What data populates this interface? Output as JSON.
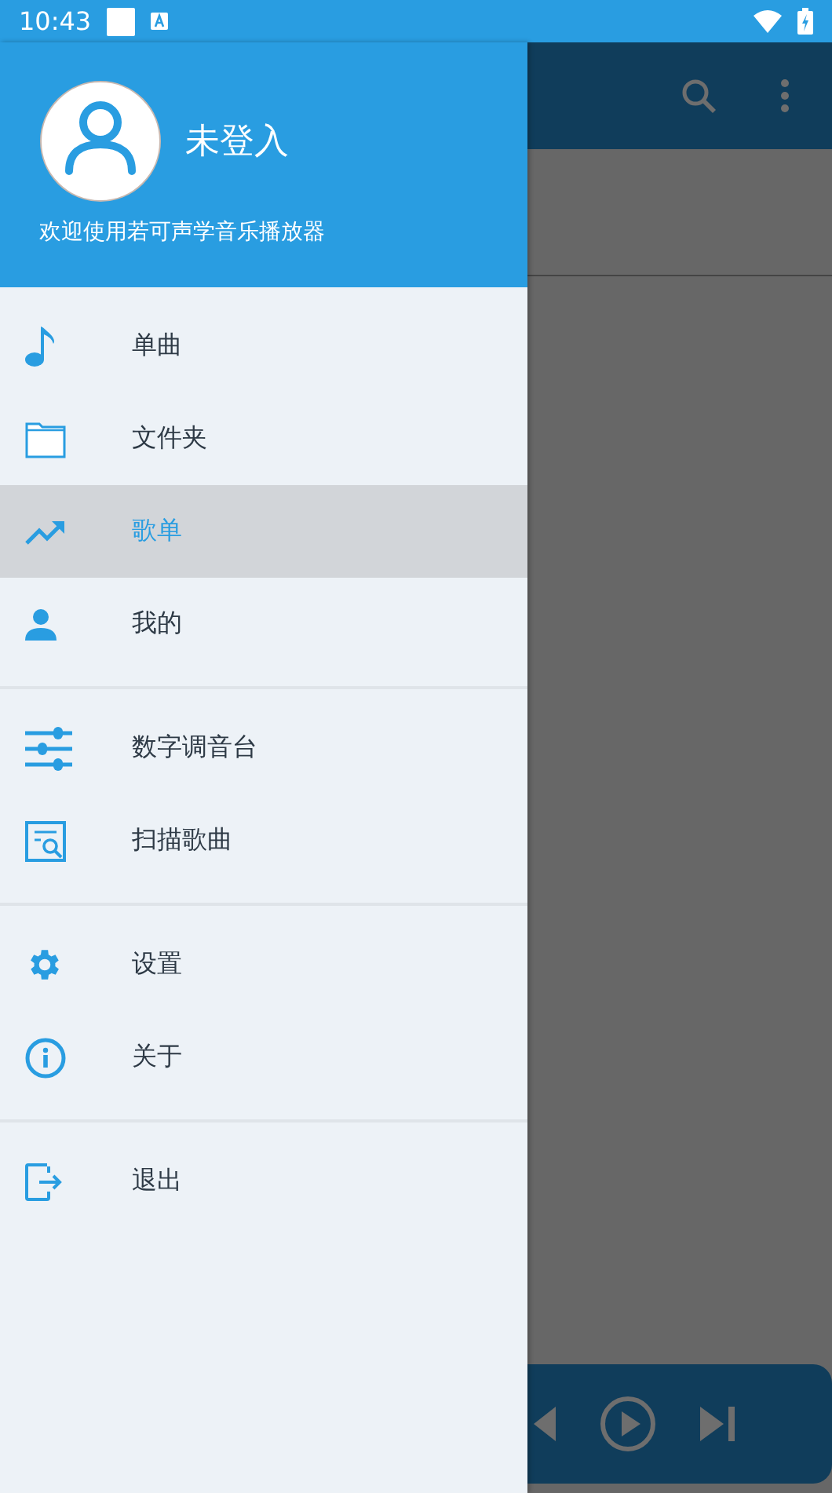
{
  "status_bar": {
    "time": "10:43"
  },
  "drawer": {
    "header": {
      "username": "未登入",
      "welcome": "欢迎使用若可声学音乐播放器"
    },
    "groups": [
      {
        "items": [
          {
            "label": "单曲",
            "selected": false
          },
          {
            "label": "文件夹",
            "selected": false
          },
          {
            "label": "歌单",
            "selected": true
          },
          {
            "label": "我的",
            "selected": false
          }
        ]
      },
      {
        "items": [
          {
            "label": "数字调音台",
            "selected": false
          },
          {
            "label": "扫描歌曲",
            "selected": false
          }
        ]
      },
      {
        "items": [
          {
            "label": "设置",
            "selected": false
          },
          {
            "label": "关于",
            "selected": false
          }
        ]
      },
      {
        "items": [
          {
            "label": "退出",
            "selected": false
          }
        ]
      }
    ]
  }
}
